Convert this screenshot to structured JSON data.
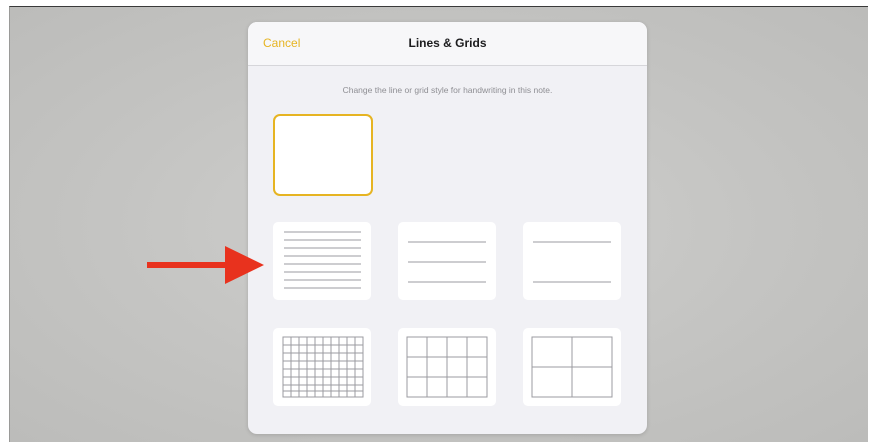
{
  "sheet": {
    "cancel_label": "Cancel",
    "title": "Lines & Grids",
    "description": "Change the line or grid style for handwriting in this note."
  },
  "styles": [
    {
      "name": "blank",
      "selected": true
    },
    {
      "name": "lines-small",
      "selected": false
    },
    {
      "name": "lines-medium",
      "selected": false
    },
    {
      "name": "lines-large",
      "selected": false
    },
    {
      "name": "grid-small",
      "selected": false
    },
    {
      "name": "grid-medium",
      "selected": false
    },
    {
      "name": "grid-large",
      "selected": false
    }
  ],
  "colors": {
    "accent": "#e6b422",
    "arrow": "#e8321e",
    "line": "#9b9ba0"
  },
  "annotation": {
    "icon": "red-arrow-icon"
  }
}
